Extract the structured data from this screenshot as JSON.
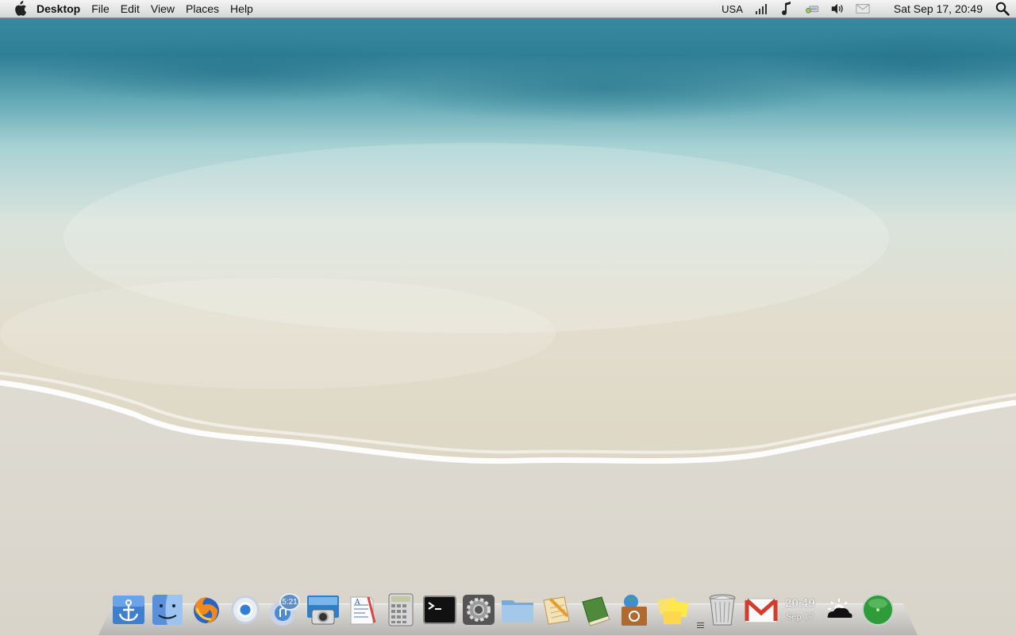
{
  "menubar": {
    "app_name": "Desktop",
    "menus": [
      "File",
      "Edit",
      "View",
      "Places",
      "Help"
    ],
    "keyboard_layout": "USA",
    "clock": "Sat Sep 17, 20:49"
  },
  "dock": {
    "items": [
      "anchor-app-icon",
      "finder-icon",
      "firefox-icon",
      "chrome-icon",
      "itunes-clock-icon",
      "screenshot-camera-icon",
      "text-editor-icon",
      "calculator-icon",
      "terminal-icon",
      "system-preferences-icon",
      "folder-icon",
      "notes-pencil-icon",
      "book-icon",
      "ubuntu-software-box-icon",
      "sticky-notes-icon",
      "trash-icon",
      "gmail-icon",
      "weather-cloud-icon",
      "green-orb-icon"
    ],
    "itunes_badge": "5:21",
    "clock_widget": {
      "time": "20:49",
      "date": "Sep 17"
    }
  },
  "colors": {
    "sea_deep": "#2d7f94",
    "sea_shallow": "#bfe0e2",
    "sand": "#e1ddd4",
    "foam": "#ffffff",
    "menubar": "#e4e4e4"
  }
}
